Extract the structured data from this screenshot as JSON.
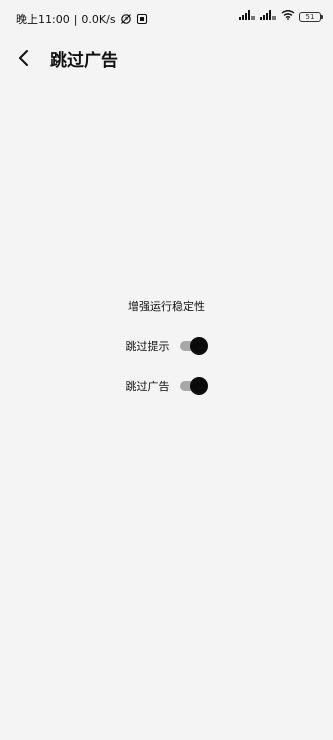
{
  "status_bar": {
    "time": "晚上11:00",
    "separator": "|",
    "speed": "0.0K/s",
    "battery": "51"
  },
  "header": {
    "title": "跳过广告"
  },
  "main": {
    "label": "增强运行稳定性",
    "toggles": [
      {
        "label": "跳过提示",
        "on": true
      },
      {
        "label": "跳过广告",
        "on": true
      }
    ]
  }
}
